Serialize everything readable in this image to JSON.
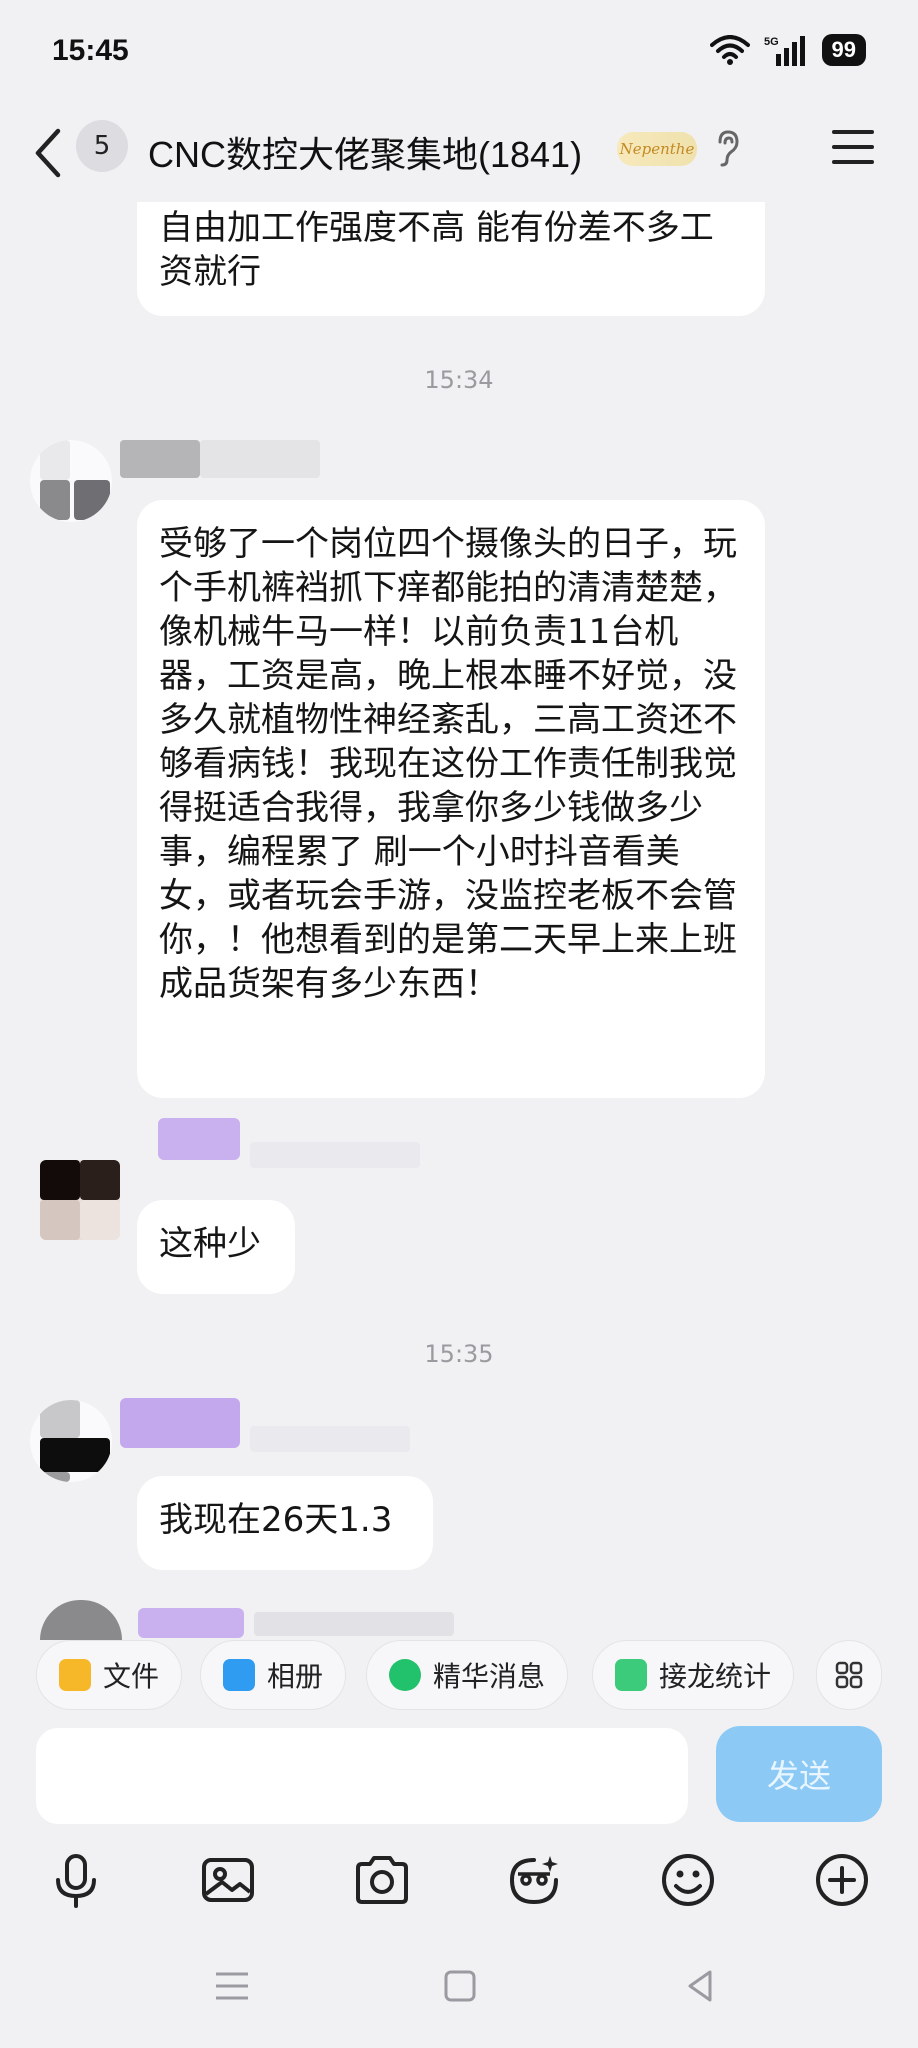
{
  "status_bar": {
    "time": "15:45",
    "network": "5G",
    "battery": "99"
  },
  "header": {
    "unread_count": "5",
    "title": "CNC数控大佬聚集地(1841)",
    "badge": "Nepenthe"
  },
  "messages": {
    "top_partial": "自由加工作强度不高 能有份差不多工资就行",
    "time1": "15:34",
    "long_message": "受够了一个岗位四个摄像头的日子，玩个手机裤裆抓下痒都能拍的清清楚楚，像机械牛马一样！以前负责11台机器，工资是高，晚上根本睡不好觉，没多久就植物性神经紊乱，三高工资还不够看病钱！我现在这份工作责任制我觉得挺适合我得，我拿你多少钱做多少事，编程累了 刷一个小时抖音看美女，或者玩会手游，没监控老板不会管你，！他想看到的是第二天早上来上班 成品货架有多少东西！",
    "short_message": "这种少",
    "time2": "15:35",
    "salary_message": "我现在26天1.3"
  },
  "quick_bar": {
    "file": "文件",
    "album": "相册",
    "highlights": "精华消息",
    "relay": "接龙统计"
  },
  "input": {
    "send": "发送"
  },
  "colors": {
    "background": "#f1f1f4",
    "bubble": "#ffffff",
    "send_button": "#8ccaf5",
    "accent_purple": "#c9b0ef"
  }
}
